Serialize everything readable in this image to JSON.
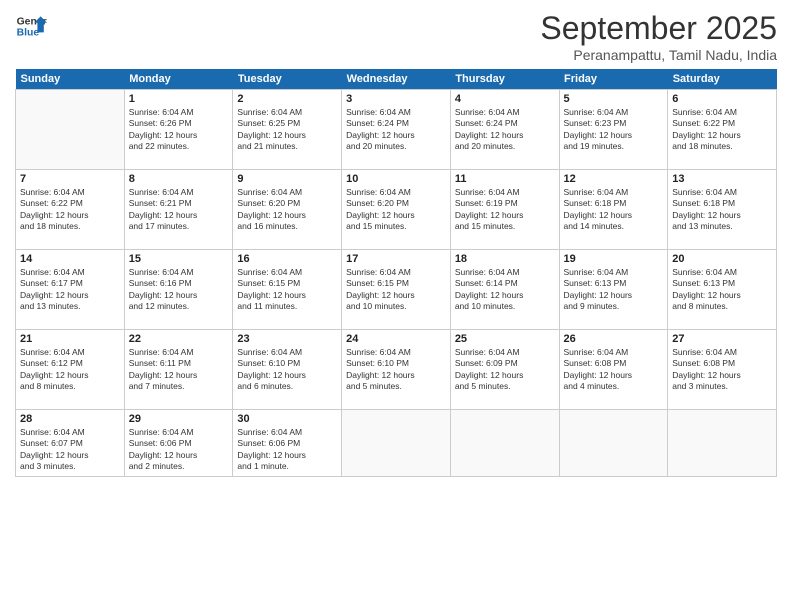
{
  "logo": {
    "line1": "General",
    "line2": "Blue"
  },
  "title": "September 2025",
  "subtitle": "Peranampattu, Tamil Nadu, India",
  "days_of_week": [
    "Sunday",
    "Monday",
    "Tuesday",
    "Wednesday",
    "Thursday",
    "Friday",
    "Saturday"
  ],
  "weeks": [
    [
      null,
      {
        "day": "1",
        "sunrise": "6:04 AM",
        "sunset": "6:26 PM",
        "daylight": "12 hours and 22 minutes."
      },
      {
        "day": "2",
        "sunrise": "6:04 AM",
        "sunset": "6:25 PM",
        "daylight": "12 hours and 21 minutes."
      },
      {
        "day": "3",
        "sunrise": "6:04 AM",
        "sunset": "6:24 PM",
        "daylight": "12 hours and 20 minutes."
      },
      {
        "day": "4",
        "sunrise": "6:04 AM",
        "sunset": "6:24 PM",
        "daylight": "12 hours and 20 minutes."
      },
      {
        "day": "5",
        "sunrise": "6:04 AM",
        "sunset": "6:23 PM",
        "daylight": "12 hours and 19 minutes."
      },
      {
        "day": "6",
        "sunrise": "6:04 AM",
        "sunset": "6:22 PM",
        "daylight": "12 hours and 18 minutes."
      }
    ],
    [
      {
        "day": "7",
        "sunrise": "6:04 AM",
        "sunset": "6:22 PM",
        "daylight": "12 hours and 18 minutes."
      },
      {
        "day": "8",
        "sunrise": "6:04 AM",
        "sunset": "6:21 PM",
        "daylight": "12 hours and 17 minutes."
      },
      {
        "day": "9",
        "sunrise": "6:04 AM",
        "sunset": "6:20 PM",
        "daylight": "12 hours and 16 minutes."
      },
      {
        "day": "10",
        "sunrise": "6:04 AM",
        "sunset": "6:20 PM",
        "daylight": "12 hours and 15 minutes."
      },
      {
        "day": "11",
        "sunrise": "6:04 AM",
        "sunset": "6:19 PM",
        "daylight": "12 hours and 15 minutes."
      },
      {
        "day": "12",
        "sunrise": "6:04 AM",
        "sunset": "6:18 PM",
        "daylight": "12 hours and 14 minutes."
      },
      {
        "day": "13",
        "sunrise": "6:04 AM",
        "sunset": "6:18 PM",
        "daylight": "12 hours and 13 minutes."
      }
    ],
    [
      {
        "day": "14",
        "sunrise": "6:04 AM",
        "sunset": "6:17 PM",
        "daylight": "12 hours and 13 minutes."
      },
      {
        "day": "15",
        "sunrise": "6:04 AM",
        "sunset": "6:16 PM",
        "daylight": "12 hours and 12 minutes."
      },
      {
        "day": "16",
        "sunrise": "6:04 AM",
        "sunset": "6:15 PM",
        "daylight": "12 hours and 11 minutes."
      },
      {
        "day": "17",
        "sunrise": "6:04 AM",
        "sunset": "6:15 PM",
        "daylight": "12 hours and 10 minutes."
      },
      {
        "day": "18",
        "sunrise": "6:04 AM",
        "sunset": "6:14 PM",
        "daylight": "12 hours and 10 minutes."
      },
      {
        "day": "19",
        "sunrise": "6:04 AM",
        "sunset": "6:13 PM",
        "daylight": "12 hours and 9 minutes."
      },
      {
        "day": "20",
        "sunrise": "6:04 AM",
        "sunset": "6:13 PM",
        "daylight": "12 hours and 8 minutes."
      }
    ],
    [
      {
        "day": "21",
        "sunrise": "6:04 AM",
        "sunset": "6:12 PM",
        "daylight": "12 hours and 8 minutes."
      },
      {
        "day": "22",
        "sunrise": "6:04 AM",
        "sunset": "6:11 PM",
        "daylight": "12 hours and 7 minutes."
      },
      {
        "day": "23",
        "sunrise": "6:04 AM",
        "sunset": "6:10 PM",
        "daylight": "12 hours and 6 minutes."
      },
      {
        "day": "24",
        "sunrise": "6:04 AM",
        "sunset": "6:10 PM",
        "daylight": "12 hours and 5 minutes."
      },
      {
        "day": "25",
        "sunrise": "6:04 AM",
        "sunset": "6:09 PM",
        "daylight": "12 hours and 5 minutes."
      },
      {
        "day": "26",
        "sunrise": "6:04 AM",
        "sunset": "6:08 PM",
        "daylight": "12 hours and 4 minutes."
      },
      {
        "day": "27",
        "sunrise": "6:04 AM",
        "sunset": "6:08 PM",
        "daylight": "12 hours and 3 minutes."
      }
    ],
    [
      {
        "day": "28",
        "sunrise": "6:04 AM",
        "sunset": "6:07 PM",
        "daylight": "12 hours and 3 minutes."
      },
      {
        "day": "29",
        "sunrise": "6:04 AM",
        "sunset": "6:06 PM",
        "daylight": "12 hours and 2 minutes."
      },
      {
        "day": "30",
        "sunrise": "6:04 AM",
        "sunset": "6:06 PM",
        "daylight": "12 hours and 1 minute."
      },
      null,
      null,
      null,
      null
    ]
  ]
}
